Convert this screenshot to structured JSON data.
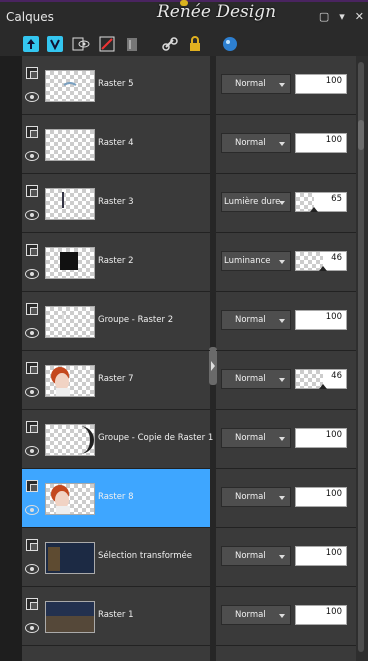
{
  "window": {
    "title": "Calques",
    "logo_text": "Renée Design"
  },
  "window_buttons": [
    "▢",
    "▾",
    "✕"
  ],
  "toolbar": {
    "icons": [
      "new-raster-layer-icon",
      "new-vector-layer-icon",
      "new-adjustment-layer-icon",
      "new-mask-layer-icon",
      "delete-layer-icon",
      "link-icon",
      "lock-icon",
      "palette-icon"
    ],
    "colors": {
      "cyan": "#34c6f0",
      "highlight": "#3ea6ff"
    }
  },
  "layers": [
    {
      "name": "Raster 5",
      "blend": "Normal",
      "opacity": 100,
      "selected": false,
      "thumb": "raster5"
    },
    {
      "name": "Raster 4",
      "blend": "Normal",
      "opacity": 100,
      "selected": false,
      "thumb": "empty"
    },
    {
      "name": "Raster 3",
      "blend": "Lumière dure",
      "opacity": 65,
      "selected": false,
      "thumb": "raster3"
    },
    {
      "name": "Raster 2",
      "blend": "Luminance",
      "opacity": 46,
      "selected": false,
      "thumb": "raster2"
    },
    {
      "name": "Groupe - Raster 2",
      "blend": "Normal",
      "opacity": 100,
      "selected": false,
      "thumb": "groupe"
    },
    {
      "name": "Raster 7",
      "blend": "Normal",
      "opacity": 46,
      "selected": false,
      "thumb": "portrait"
    },
    {
      "name": "Groupe - Copie de Raster 1",
      "blend": "Normal",
      "opacity": 100,
      "selected": false,
      "thumb": "moon"
    },
    {
      "name": "Raster 8",
      "blend": "Normal",
      "opacity": 100,
      "selected": true,
      "thumb": "portrait"
    },
    {
      "name": "Sélection transformée",
      "blend": "Normal",
      "opacity": 100,
      "selected": false,
      "thumb": "selection"
    },
    {
      "name": "Raster 1",
      "blend": "Normal",
      "opacity": 100,
      "selected": false,
      "thumb": "raster1"
    }
  ]
}
